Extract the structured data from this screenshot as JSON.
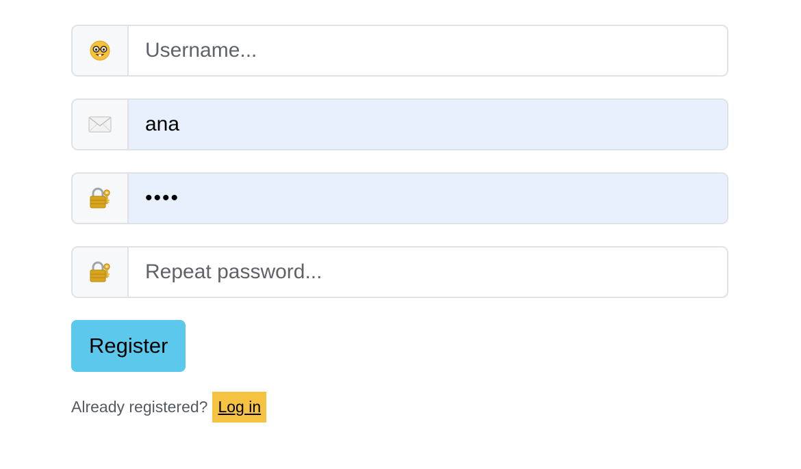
{
  "form": {
    "username": {
      "icon": "nerd-face-icon",
      "value": "",
      "placeholder": "Username..."
    },
    "email": {
      "icon": "envelope-icon",
      "value": "ana",
      "placeholder": ""
    },
    "password": {
      "icon": "locked-with-key-icon",
      "value": "abcd",
      "placeholder": ""
    },
    "repeat_password": {
      "icon": "locked-with-key-icon",
      "value": "",
      "placeholder": "Repeat password..."
    },
    "register_label": "Register"
  },
  "footer": {
    "prompt": "Already registered?",
    "login_label": "Log in"
  },
  "colors": {
    "button": "#5bc8ec",
    "autofill_bg": "#e8f0fe",
    "link_highlight": "#f5c242",
    "border": "#dee2e6",
    "addon_bg": "#f7f8f9"
  }
}
